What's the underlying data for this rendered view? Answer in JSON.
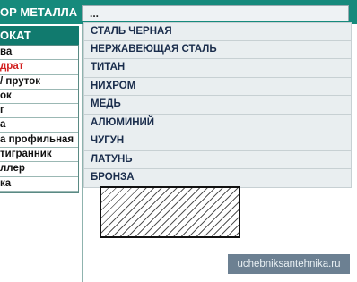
{
  "header": {
    "title": "ОР МЕТАЛЛА",
    "dropdown_value": "..."
  },
  "sidebar": {
    "heading": "ОКАТ",
    "items": [
      {
        "label": "ва"
      },
      {
        "label": "драт"
      },
      {
        "label": "/ пруток"
      },
      {
        "label": "ок"
      },
      {
        "label": "г"
      },
      {
        "label": "а"
      },
      {
        "label": "а профильная"
      },
      {
        "label": "тигранник"
      },
      {
        "label": "ллер"
      },
      {
        "label": "ка"
      }
    ],
    "active_index": 1
  },
  "menu": {
    "items": [
      {
        "label": "СТАЛЬ ЧЕРНАЯ"
      },
      {
        "label": "НЕРЖАВЕЮЩАЯ СТАЛЬ"
      },
      {
        "label": "ТИТАН"
      },
      {
        "label": "НИХРОМ"
      },
      {
        "label": "МЕДЬ"
      },
      {
        "label": "АЛЮМИНИЙ"
      },
      {
        "label": "ЧУГУН"
      },
      {
        "label": "ЛАТУНЬ"
      },
      {
        "label": "БРОНЗА"
      }
    ]
  },
  "watermark": "uchebniksantehnika.ru",
  "colors": {
    "header_bg": "#168a7c",
    "sidebar_head_bg": "#117a6e",
    "active_item": "#d21f1f",
    "menu_text": "#1a2d4c"
  }
}
